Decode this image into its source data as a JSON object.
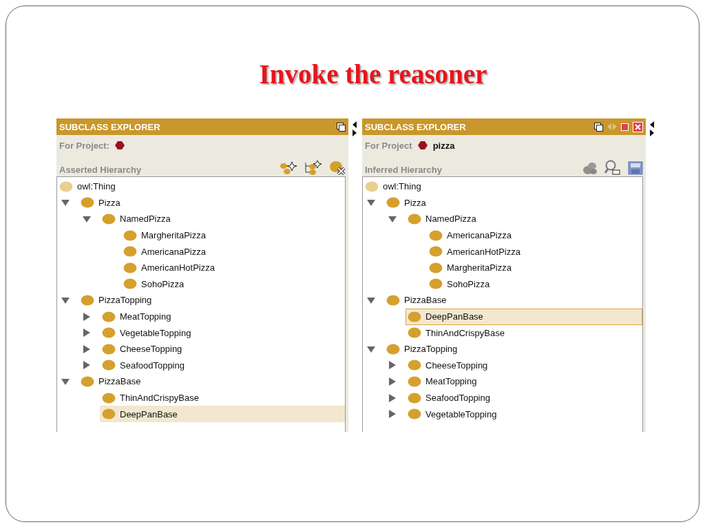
{
  "slide": {
    "title": "Invoke the reasoner"
  },
  "panels": [
    {
      "title": "SUBCLASS EXPLORER",
      "project_label": "For Project:",
      "hierarchy_label": "Asserted Hierarchy",
      "root": "owl:Thing",
      "tree": [
        {
          "label": "Pizza",
          "expanded": true,
          "selected": false,
          "children": [
            {
              "label": "NamedPizza",
              "expanded": true,
              "selected": false,
              "children": [
                {
                  "label": "MargheritaPizza",
                  "selected": false
                },
                {
                  "label": "AmericanaPizza",
                  "selected": false
                },
                {
                  "label": "AmericanHotPizza",
                  "selected": false
                },
                {
                  "label": "SohoPizza",
                  "selected": false
                }
              ]
            }
          ]
        },
        {
          "label": "PizzaTopping",
          "expanded": true,
          "selected": false,
          "children": [
            {
              "label": "MeatTopping",
              "expanded": false,
              "selected": false
            },
            {
              "label": "VegetableTopping",
              "expanded": false,
              "selected": false
            },
            {
              "label": "CheeseTopping",
              "expanded": false,
              "selected": false
            },
            {
              "label": "SeafoodTopping",
              "expanded": false,
              "selected": false
            }
          ]
        },
        {
          "label": "PizzaBase",
          "expanded": true,
          "selected": false,
          "children": [
            {
              "label": "ThinAndCrispyBase",
              "selected": false
            },
            {
              "label": "DeepPanBase",
              "selected": true
            }
          ]
        }
      ]
    },
    {
      "title": "SUBCLASS EXPLORER",
      "project_label": "For Project",
      "project_name": "pizza",
      "hierarchy_label": "Inferred Hierarchy",
      "root": "owl:Thing",
      "tree": [
        {
          "label": "Pizza",
          "expanded": true,
          "selected": false,
          "children": [
            {
              "label": "NamedPizza",
              "expanded": true,
              "selected": false,
              "children": [
                {
                  "label": "AmericanaPizza",
                  "selected": false
                },
                {
                  "label": "AmericanHotPizza",
                  "selected": false
                },
                {
                  "label": "MargheritaPizza",
                  "selected": false
                },
                {
                  "label": "SohoPizza",
                  "selected": false
                }
              ]
            }
          ]
        },
        {
          "label": "PizzaBase",
          "expanded": true,
          "selected": false,
          "children": [
            {
              "label": "DeepPanBase",
              "selected": true
            },
            {
              "label": "ThinAndCrispyBase",
              "selected": false
            }
          ]
        },
        {
          "label": "PizzaTopping",
          "expanded": true,
          "selected": false,
          "children": [
            {
              "label": "CheeseTopping",
              "expanded": false,
              "selected": false
            },
            {
              "label": "MeatTopping",
              "expanded": false,
              "selected": false
            },
            {
              "label": "SeafoodTopping",
              "expanded": false,
              "selected": false
            },
            {
              "label": "VegetableTopping",
              "expanded": false,
              "selected": false
            }
          ]
        }
      ]
    }
  ]
}
